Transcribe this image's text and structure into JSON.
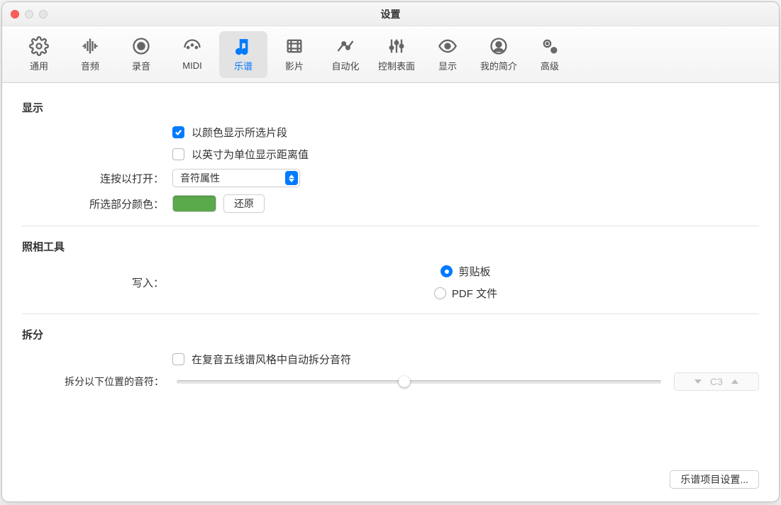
{
  "window": {
    "title": "设置"
  },
  "tabs": [
    {
      "id": "general",
      "label": "通用"
    },
    {
      "id": "audio",
      "label": "音频"
    },
    {
      "id": "record",
      "label": "录音"
    },
    {
      "id": "midi",
      "label": "MIDI"
    },
    {
      "id": "score",
      "label": "乐谱"
    },
    {
      "id": "movie",
      "label": "影片"
    },
    {
      "id": "auto",
      "label": "自动化"
    },
    {
      "id": "surfaces",
      "label": "控制表面"
    },
    {
      "id": "display",
      "label": "显示"
    },
    {
      "id": "myinfo",
      "label": "我的简介"
    },
    {
      "id": "advanced",
      "label": "高级"
    }
  ],
  "sections": {
    "display": {
      "title": "显示",
      "color_selected_parts": {
        "label": "以颜色显示所选片段",
        "checked": true
      },
      "show_distance_inches": {
        "label": "以英寸为单位显示距离值",
        "checked": false
      },
      "doubleclick_label": "连按以打开：",
      "doubleclick_value": "音符属性",
      "selection_color_label": "所选部分颜色：",
      "selection_color": "#5aaa4b",
      "reset_label": "还原"
    },
    "camera": {
      "title": "照相工具",
      "write_to_label": "写入：",
      "clipboard_label": "剪贴板",
      "pdf_label": "PDF 文件",
      "selected": "clipboard"
    },
    "split": {
      "title": "拆分",
      "auto_split": {
        "label": "在复音五线谱风格中自动拆分音符",
        "checked": false
      },
      "split_below_label": "拆分以下位置的音符：",
      "split_value": "C3",
      "slider_pos_percent": 47
    }
  },
  "footer_button": "乐谱项目设置..."
}
